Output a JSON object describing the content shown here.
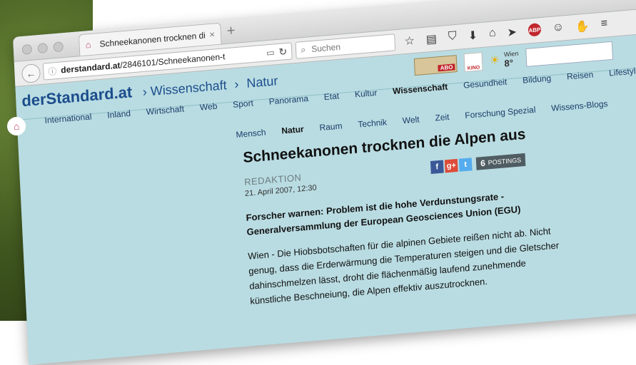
{
  "browser": {
    "tab_title": "Schneekanonen trocknen di...",
    "tab_close": "×",
    "new_tab": "+",
    "url_domain": "derstandard.at",
    "url_path": "/2846101/Schneekanonen-t",
    "search_placeholder": "Suchen"
  },
  "site": {
    "logo": "derStandard.at",
    "breadcrumb": [
      "Wissenschaft",
      "Natur"
    ],
    "breadcrumb_sep": "›",
    "abo_label": "ABO",
    "kino_label": "KINO",
    "weather_city": "Wien",
    "weather_temp": "8°"
  },
  "nav": {
    "main": [
      "International",
      "Inland",
      "Wirtschaft",
      "Web",
      "Sport",
      "Panorama",
      "Etat",
      "Kultur",
      "Wissenschaft",
      "Gesundheit",
      "Bildung",
      "Reisen",
      "Lifestyle"
    ],
    "main_active": "Wissenschaft",
    "sub": [
      "Mensch",
      "Natur",
      "Raum",
      "Technik",
      "Welt",
      "Zeit",
      "Forschung Spezial",
      "Wissens-Blogs"
    ],
    "sub_active": "Natur"
  },
  "article": {
    "title": "Schneekanonen trocknen die Alpen aus",
    "author": "REDAKTION",
    "date": "21. April 2007, 12:30",
    "postings_count": "6",
    "postings_label": "POSTINGS",
    "lead": "Forscher warnen: Problem ist die hohe Verdunstungsrate - Generalversammlung der European Geosciences Union (EGU)",
    "body": "Wien - Die Hiobsbotschaften für die alpinen Gebiete reißen nicht ab. Nicht genug, dass die Erderwärmung die Temperaturen steigen und die Gletscher dahinschmelzen lässt, droht die flächenmäßig laufend zunehmende künstliche Beschneiung, die Alpen effektiv auszutrocknen."
  },
  "colors": {
    "site_background": "#b9dce2",
    "logo_blue": "#1b4d8c"
  }
}
